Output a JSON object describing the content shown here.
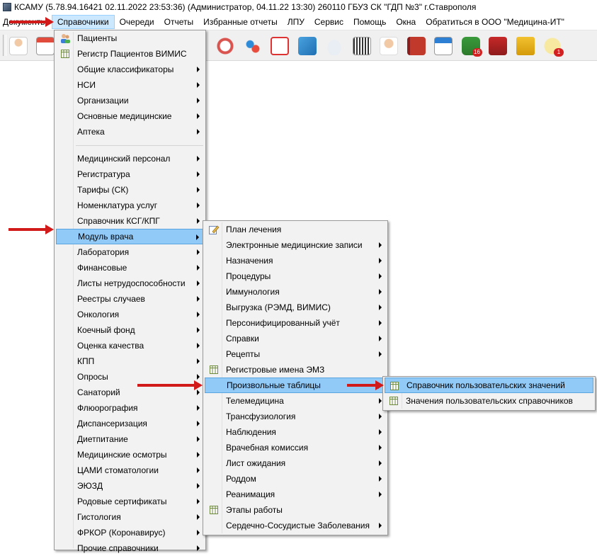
{
  "window": {
    "title": "КСАМУ (5.78.94.16421 02.11.2022 23:53:36) (Администратор, 04.11.22 13:30)  260110 ГБУЗ СК \"ГДП №3\" г.Ставрополя"
  },
  "menubar": [
    {
      "label": "Документы",
      "name": "menu-documents"
    },
    {
      "label": "Справочники",
      "name": "menu-references",
      "active": true
    },
    {
      "label": "Очереди",
      "name": "menu-queues"
    },
    {
      "label": "Отчеты",
      "name": "menu-reports"
    },
    {
      "label": "Избранные отчеты",
      "name": "menu-favorite-reports"
    },
    {
      "label": "ЛПУ",
      "name": "menu-lpu"
    },
    {
      "label": "Сервис",
      "name": "menu-service"
    },
    {
      "label": "Помощь",
      "name": "menu-help"
    },
    {
      "label": "Окна",
      "name": "menu-windows"
    },
    {
      "label": "Обратиться в ООО \"Медицина-ИТ\"",
      "name": "menu-contact"
    }
  ],
  "toolbar": {
    "icons": [
      "doctor-icon",
      "calendar-icon",
      "stopwatch-icon",
      "pills-icon",
      "first-aid-icon",
      "basket-icon",
      "cloud-icon",
      "barcode-icon",
      "nurse-icon",
      "book-icon",
      "schedule-icon",
      "usb-badge-icon",
      "a-letter-icon",
      "padlock-icon",
      "chat-notification-icon"
    ],
    "usb_badge": "16",
    "chat_badge": "1"
  },
  "menu1": {
    "items": [
      {
        "label": "Пациенты",
        "icon": "patients-icon",
        "sub": false
      },
      {
        "label": "Регистр Пациентов ВИМИС",
        "icon": "grid-icon",
        "sub": false
      },
      {
        "label": "Общие классификаторы",
        "sub": true
      },
      {
        "label": "НСИ",
        "sub": true
      },
      {
        "label": "Организации",
        "sub": true
      },
      {
        "label": "Основные медицинские",
        "sub": true
      },
      {
        "label": "Аптека",
        "sub": true
      },
      {
        "sep": true
      },
      {
        "label": "Медицинский персонал",
        "sub": true
      },
      {
        "label": "Регистратура",
        "sub": true
      },
      {
        "label": "Тарифы (СК)",
        "sub": true
      },
      {
        "label": "Номенклатура услуг",
        "sub": true
      },
      {
        "label": "Справочник КСГ/КПГ",
        "sub": true
      },
      {
        "label": "Модуль врача",
        "sub": true,
        "hl": true
      },
      {
        "label": "Лаборатория",
        "sub": true
      },
      {
        "label": "Финансовые",
        "sub": true
      },
      {
        "label": "Листы нетрудоспособности",
        "sub": true
      },
      {
        "label": "Реестры случаев",
        "sub": true
      },
      {
        "label": "Онкология",
        "sub": true
      },
      {
        "label": "Коечный фонд",
        "sub": true
      },
      {
        "label": "Оценка качества",
        "sub": true
      },
      {
        "label": "КПП",
        "sub": true
      },
      {
        "label": "Опросы",
        "sub": true
      },
      {
        "label": "Санаторий",
        "sub": true
      },
      {
        "label": "Флюорография",
        "sub": true
      },
      {
        "label": "Диспансеризация",
        "sub": true
      },
      {
        "label": "Диетпитание",
        "sub": true
      },
      {
        "label": "Медицинские осмотры",
        "sub": true
      },
      {
        "label": "ЦАМИ стоматологии",
        "sub": true
      },
      {
        "label": "ЭЮЗД",
        "sub": true
      },
      {
        "label": "Родовые сертификаты",
        "sub": true
      },
      {
        "label": "Гистология",
        "sub": true
      },
      {
        "label": "ФРКОР (Коронавирус)",
        "sub": true
      },
      {
        "label": "Прочие справочники",
        "sub": true
      }
    ]
  },
  "menu2": {
    "items": [
      {
        "label": "План лечения",
        "icon": "edit-icon",
        "sub": false
      },
      {
        "label": "Электронные медицинские записи",
        "sub": true
      },
      {
        "label": "Назначения",
        "sub": true
      },
      {
        "label": "Процедуры",
        "sub": true
      },
      {
        "label": "Иммунология",
        "sub": true
      },
      {
        "label": "Выгрузка (РЭМД, ВИМИС)",
        "sub": true
      },
      {
        "label": "Персонифицированный учёт",
        "sub": true
      },
      {
        "label": "Справки",
        "sub": true
      },
      {
        "label": "Рецепты",
        "sub": true
      },
      {
        "label": "Регистровые имена ЭМЗ",
        "icon": "grid-icon",
        "sub": false
      },
      {
        "label": "Произвольные таблицы",
        "sub": true,
        "hl": true
      },
      {
        "label": "Телемедицина",
        "sub": true
      },
      {
        "label": "Трансфузиология",
        "sub": true
      },
      {
        "label": "Наблюдения",
        "sub": true
      },
      {
        "label": "Врачебная комиссия",
        "sub": true
      },
      {
        "label": "Лист ожидания",
        "sub": true
      },
      {
        "label": "Роддом",
        "sub": true
      },
      {
        "label": "Реанимация",
        "sub": true
      },
      {
        "label": "Этапы работы",
        "icon": "grid-icon",
        "sub": false
      },
      {
        "label": "Сердечно-Сосудистые Заболевания",
        "sub": true
      }
    ]
  },
  "menu3": {
    "items": [
      {
        "label": "Справочник пользовательских значений",
        "icon": "grid-icon",
        "hl": true
      },
      {
        "label": "Значения пользовательских справочников",
        "icon": "grid-icon"
      }
    ]
  },
  "colors": {
    "highlight": "#91c9f7",
    "menu_bg": "#f2f2f2",
    "annotation_arrow": "#d11a1a"
  }
}
